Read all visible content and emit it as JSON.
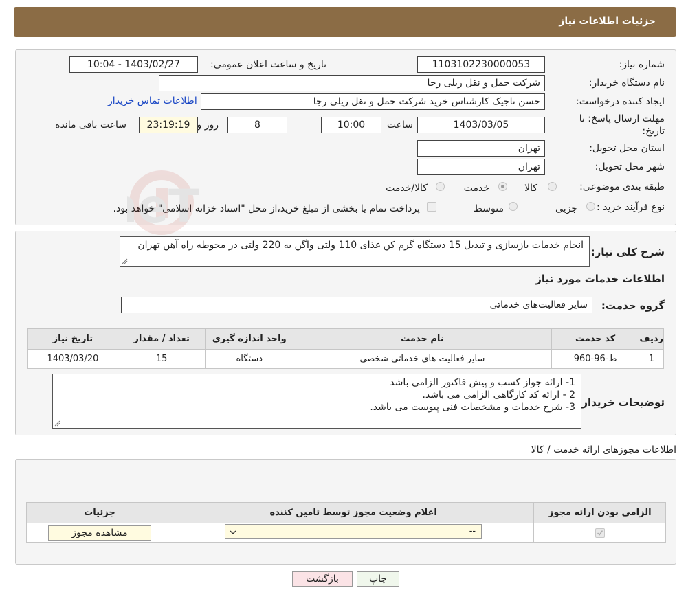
{
  "header": {
    "title": "جزئیات اطلاعات نیاز"
  },
  "form": {
    "need_number_label": "شماره نیاز:",
    "need_number": "1103102230000053",
    "announce_datetime_label": "تاریخ و ساعت اعلان عمومی:",
    "announce_datetime": "1403/02/27 - 10:04",
    "buyer_org_label": "نام دستگاه خریدار:",
    "buyer_org": "شرکت حمل و نقل ریلی رجا",
    "creator_label": "ایجاد کننده درخواست:",
    "creator": "حسن تاجیک کارشناس خرید شرکت حمل و نقل ریلی رجا",
    "contact_link": "اطلاعات تماس خریدار",
    "deadline_label_1": "مهلت ارسال پاسخ: تا",
    "deadline_label_2": "تاریخ:",
    "deadline_date": "1403/03/05",
    "time_label": "ساعت",
    "deadline_time": "10:00",
    "days_value": "8",
    "days_label": "روز و",
    "remaining_time": "23:19:19",
    "remaining_label": "ساعت باقی مانده",
    "province_label": "استان محل تحویل:",
    "province": "تهران",
    "city_label": "شهر محل تحویل:",
    "city": "تهران",
    "category_label": "طبقه بندی موضوعی:",
    "category_options": [
      "کالا",
      "خدمت",
      "کالا/خدمت"
    ],
    "purchase_type_label": "نوع فرآیند خرید :",
    "purchase_options": [
      "جزیی",
      "متوسط"
    ],
    "purchase_note": "پرداخت تمام یا بخشی از مبلغ خرید،از محل \"اسناد خزانه اسلامی\" خواهد بود."
  },
  "summary": {
    "label": "شرح کلی نیاز:",
    "text": "انجام خدمات بازسازی و تبدیل 15 دستگاه گرم کن غذای 110 ولتی واگن به 220 ولتی در محوطه راه آهن تهران",
    "services_title": "اطلاعات خدمات مورد نیاز",
    "service_group_label": "گروه خدمت:",
    "service_group": "سایر فعالیت‌های خدماتی"
  },
  "services_table": {
    "headers": [
      "ردیف",
      "کد خدمت",
      "نام خدمت",
      "واحد اندازه گیری",
      "تعداد / مقدار",
      "تاریخ نیاز"
    ],
    "rows": [
      [
        "1",
        "ط-96-960",
        "سایر فعالیت های خدماتی شخصی",
        "دستگاه",
        "15",
        "1403/03/20"
      ]
    ]
  },
  "buyer_notes": {
    "label": "توضیحات خریدار:",
    "lines": [
      "1- ارائه جواز کسب و پیش فاکتور الزامی باشد",
      "2 - ارائه کد کارگاهی الزامی می باشد.",
      "3- شرح خدمات و مشخصات فنی پیوست می باشد."
    ]
  },
  "permits": {
    "title": "اطلاعات مجوزهای ارائه خدمت / کالا",
    "headers": [
      "الزامی بودن ارائه مجوز",
      "اعلام وضعیت مجوز توسط تامین کننده",
      "جزئیات"
    ],
    "select_value": "--",
    "view_button": "مشاهده مجوز"
  },
  "actions": {
    "print": "چاپ",
    "back": "بازگشت"
  },
  "watermark": {
    "text": "AriaTender.neT"
  }
}
